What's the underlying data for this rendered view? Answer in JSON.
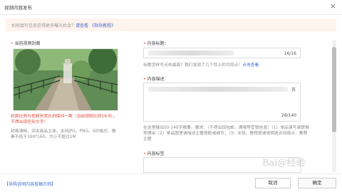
{
  "dialog": {
    "title": "视频内容发布",
    "close_glyph": "×"
  },
  "notice": {
    "prefix": "如何填写信息获得更多曝光机会？",
    "link1": "请查看",
    "link2": "《指导教程》"
  },
  "cover": {
    "label": "当前视频封面",
    "warning": "封面比例与视频长宽比例保持一致（当前视频比例16:9），不得出现任何文字！",
    "hint": "封面清晰，突出商品主体。支持JPG、PNG、GIF格式，像素不低于160*160，大小不超过1M"
  },
  "title_field": {
    "label": "内容标题：",
    "count": "16/16",
    "hint_prefix": "标题怎样写点击最高？我们发现了几个惊人的共同点！",
    "hint_link": "点击查看"
  },
  "desc_field": {
    "label": "内容描述：",
    "tail_char": "衣",
    "count": "28/140",
    "hint": "在这里输出50-140字概要，要求：（不得出现包邮、满哦等营销信息）（1）单品请写清楚推荐理由（2）单品图里请描述主要搭配或细节；（3）评测、教程搭请说明选评测观点，教程主题"
  },
  "tags_field": {
    "label": "内容标签"
  },
  "footer": {
    "guide_link": "【导购说明内容投稿示例】",
    "cancel": "取消",
    "confirm": "确定"
  },
  "watermark": "Bai@经验"
}
